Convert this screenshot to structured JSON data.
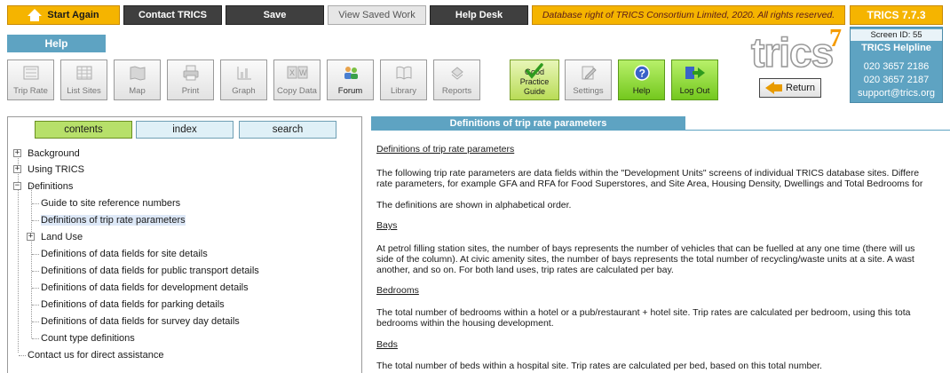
{
  "topbar": {
    "start_again": "Start Again",
    "contact": "Contact TRICS",
    "save": "Save",
    "view_saved": "View Saved Work",
    "help_desk": "Help Desk",
    "notice": "Database right of TRICS Consortium Limited, 2020. All rights reserved.",
    "version": "TRICS 7.7.3"
  },
  "help_tab": "Help",
  "toolbar": {
    "trip_rate": "Trip Rate",
    "list_sites": "List Sites",
    "map": "Map",
    "print": "Print",
    "graph": "Graph",
    "copy_data": "Copy Data",
    "forum": "Forum",
    "library": "Library",
    "reports": "Reports",
    "good_practice_1": "Good Practice",
    "good_practice_2": "Guide",
    "settings": "Settings",
    "help": "Help",
    "logout": "Log Out",
    "return": "Return"
  },
  "logo": {
    "text": "trics",
    "mark": "7"
  },
  "helpline": {
    "screen_id": "Screen ID: 55",
    "title": "TRICS Helpline",
    "phone1": "020 3657 2186",
    "phone2": "020 3657 2187",
    "email": "support@trics.org"
  },
  "left": {
    "tabs": {
      "contents": "contents",
      "index": "index",
      "search": "search"
    },
    "tree": {
      "background": "Background",
      "using": "Using TRICS",
      "definitions": "Definitions",
      "site_ref": "Guide to site reference numbers",
      "trip_rate_params": "Definitions of trip rate parameters",
      "land_use": "Land Use",
      "site_details": "Definitions of data fields for site details",
      "public_transport": "Definitions of data fields for public transport details",
      "development": "Definitions of data fields for development details",
      "parking": "Definitions of data fields for parking details",
      "survey_day": "Definitions of data fields for survey day details",
      "count_type": "Count type definitions",
      "contact": "Contact us for direct assistance"
    }
  },
  "right": {
    "title": "Definitions of trip rate parameters",
    "heading": "Definitions of trip rate parameters",
    "intro1": "The following trip rate parameters are data fields within the \"Development Units\" screens of individual TRICS database sites. Differe",
    "intro2": "rate parameters, for example GFA and RFA for Food Superstores, and Site Area, Housing Density, Dwellings and Total Bedrooms for",
    "order": "The definitions are shown in alphabetical order.",
    "bays_h": "Bays",
    "bays1": "At petrol filling station sites, the number of bays represents the number of vehicles that can be fuelled at any one time (there will us",
    "bays2": "side of the column). At civic amenity sites, the number of bays represents the total number of recycling/waste units at a site. A wast",
    "bays3": "another, and so on. For both land uses, trip rates are calculated per bay.",
    "bedrooms_h": "Bedrooms",
    "bedrooms1": "The total number of bedrooms within a hotel or a pub/restaurant + hotel site. Trip rates are calculated per bedroom, using this tota",
    "bedrooms2": "bedrooms within the housing development.",
    "beds_h": "Beds",
    "beds1": "The total number of beds within a hospital site. Trip rates are calculated per bed, based on this total number."
  }
}
